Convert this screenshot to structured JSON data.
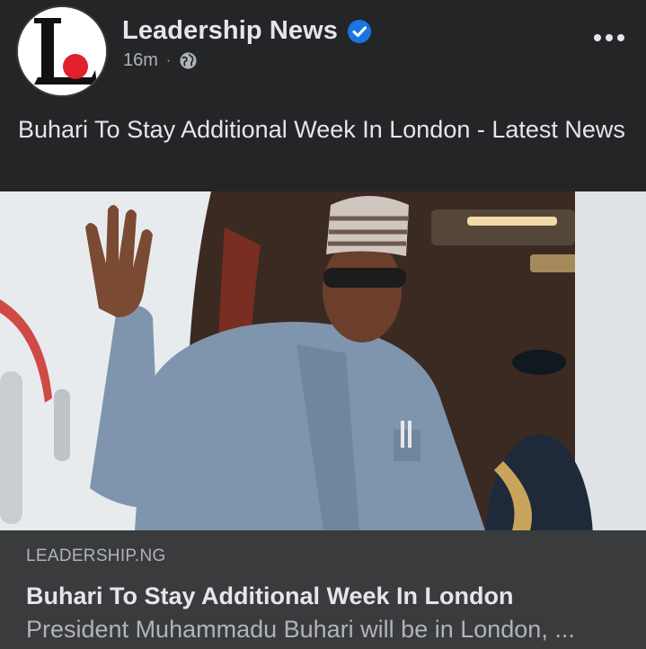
{
  "post": {
    "author": "Leadership News",
    "timestamp": "16m",
    "separator": "·",
    "audience_icon": "globe-icon",
    "verified_icon": "verified-badge-icon",
    "more_icon": "more-options-icon",
    "text": "Buhari To Stay Additional Week In London - Latest News"
  },
  "link_preview": {
    "domain": "LEADERSHIP.NG",
    "title": "Buhari To Stay Additional Week In London",
    "description": "President Muhammadu Buhari will be in London, ..."
  },
  "colors": {
    "background": "#242526",
    "card": "#3a3b3c",
    "text_primary": "#e4e6eb",
    "text_secondary": "#b0b3b8",
    "verified": "#1b74e4",
    "logo_red": "#e0202a"
  }
}
